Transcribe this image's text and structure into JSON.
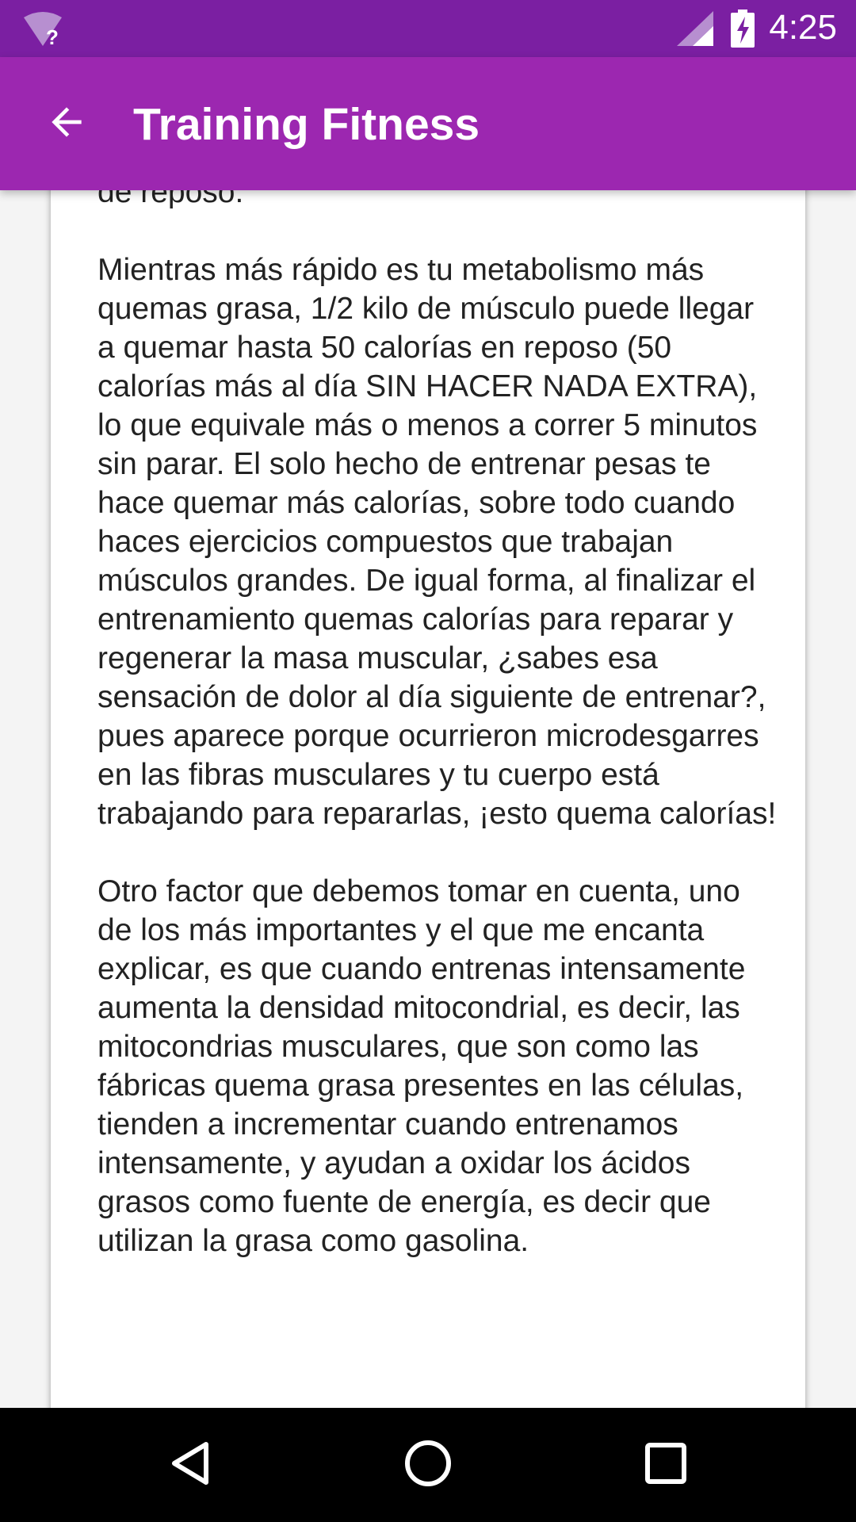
{
  "status_bar": {
    "time": "4:25",
    "icons": [
      "wifi-unknown-icon",
      "cell-signal-icon",
      "battery-charging-icon"
    ],
    "background": "#7b1fa2"
  },
  "app_bar": {
    "title": "Training Fitness",
    "back_icon": "arrow-back-icon",
    "background": "#9c27b0"
  },
  "article": {
    "text": "de reposo.\n\nMientras más rápido es tu metabolismo más quemas grasa, 1/2 kilo de músculo puede llegar a quemar hasta 50 calorías en reposo (50 calorías más al día SIN HACER NADA EXTRA), lo que equivale más o menos a correr 5 minutos sin parar. El solo hecho de entrenar pesas te hace quemar más calorías, sobre todo cuando haces ejercicios compuestos que trabajan músculos grandes. De igual forma, al finalizar el entrenamiento quemas calorías para reparar y regenerar la masa muscular, ¿sabes esa sensación de dolor al día siguiente de entrenar?, pues aparece porque ocurrieron microdesgarres en las fibras musculares y tu cuerpo está trabajando para repararlas, ¡esto quema calorías!\n\nOtro factor que debemos tomar en cuenta, uno de los más importantes y el que me encanta explicar, es que cuando entrenas intensamente aumenta la densidad mitocondrial, es decir, las mitocondrias musculares, que son como las fábricas quema grasa presentes en las células, tienden a incrementar cuando entrenamos intensamente, y ayudan a oxidar los ácidos grasos como fuente de energía, es decir que utilizan la grasa como gasolina."
  },
  "nav_bar": {
    "buttons": [
      "back-triangle-icon",
      "home-circle-icon",
      "recents-square-icon"
    ]
  }
}
